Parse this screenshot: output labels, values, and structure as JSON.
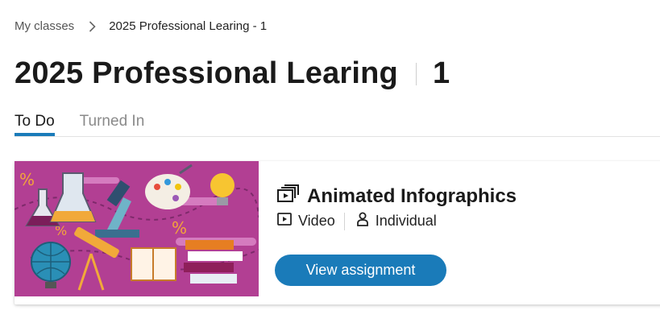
{
  "breadcrumb": {
    "parent": "My classes",
    "current": "2025 Professional Learing - 1"
  },
  "header": {
    "title": "2025 Professional Learing",
    "section": "1"
  },
  "tabs": [
    {
      "label": "To Do",
      "active": true
    },
    {
      "label": "Turned In",
      "active": false
    }
  ],
  "assignment": {
    "title": "Animated Infographics",
    "type": "Video",
    "mode": "Individual",
    "button_label": "View assignment",
    "thumbnail_icon": "science-education-illustration",
    "title_icon": "media-assignment-icon",
    "type_icon": "video-play-icon",
    "mode_icon": "person-icon"
  },
  "colors": {
    "accent": "#1a7bb9",
    "thumbnail_bg": "#b23f93"
  }
}
